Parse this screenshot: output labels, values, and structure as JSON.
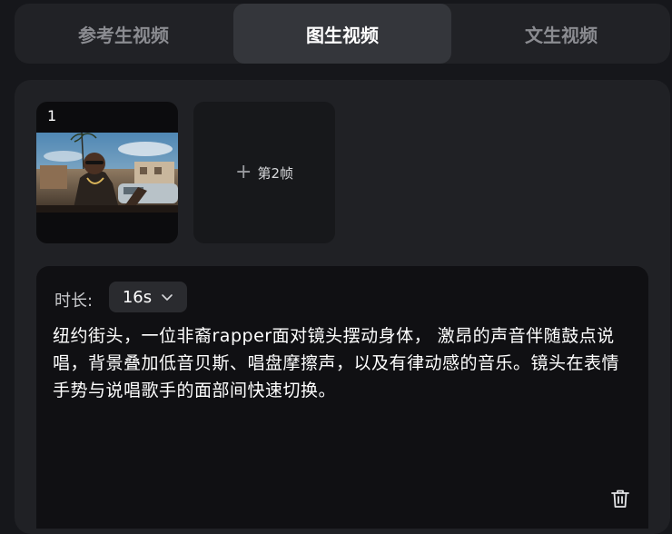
{
  "tabs": [
    {
      "label": "参考生视频",
      "active": false
    },
    {
      "label": "图生视频",
      "active": true
    },
    {
      "label": "文生视频",
      "active": false
    }
  ],
  "frames": {
    "frame1_number": "1",
    "add_frame_label": "第2帧"
  },
  "prompt": {
    "duration_label": "时长:",
    "duration_value": "16s",
    "text": "纽约街头，一位非裔rapper面对镜头摆动身体， 激昂的声音伴随鼓点说唱，背景叠加低音贝斯、唱盘摩擦声，以及有律动感的音乐。镜头在表情手势与说唱歌手的面部间快速切换。"
  },
  "icons": {
    "add": "plus-icon",
    "dropdown": "chevron-down-icon",
    "delete": "trash-icon"
  },
  "colors": {
    "background": "#16171b",
    "active_tab": "#34363b",
    "panel": "#202125",
    "prompt_box": "#101013"
  }
}
